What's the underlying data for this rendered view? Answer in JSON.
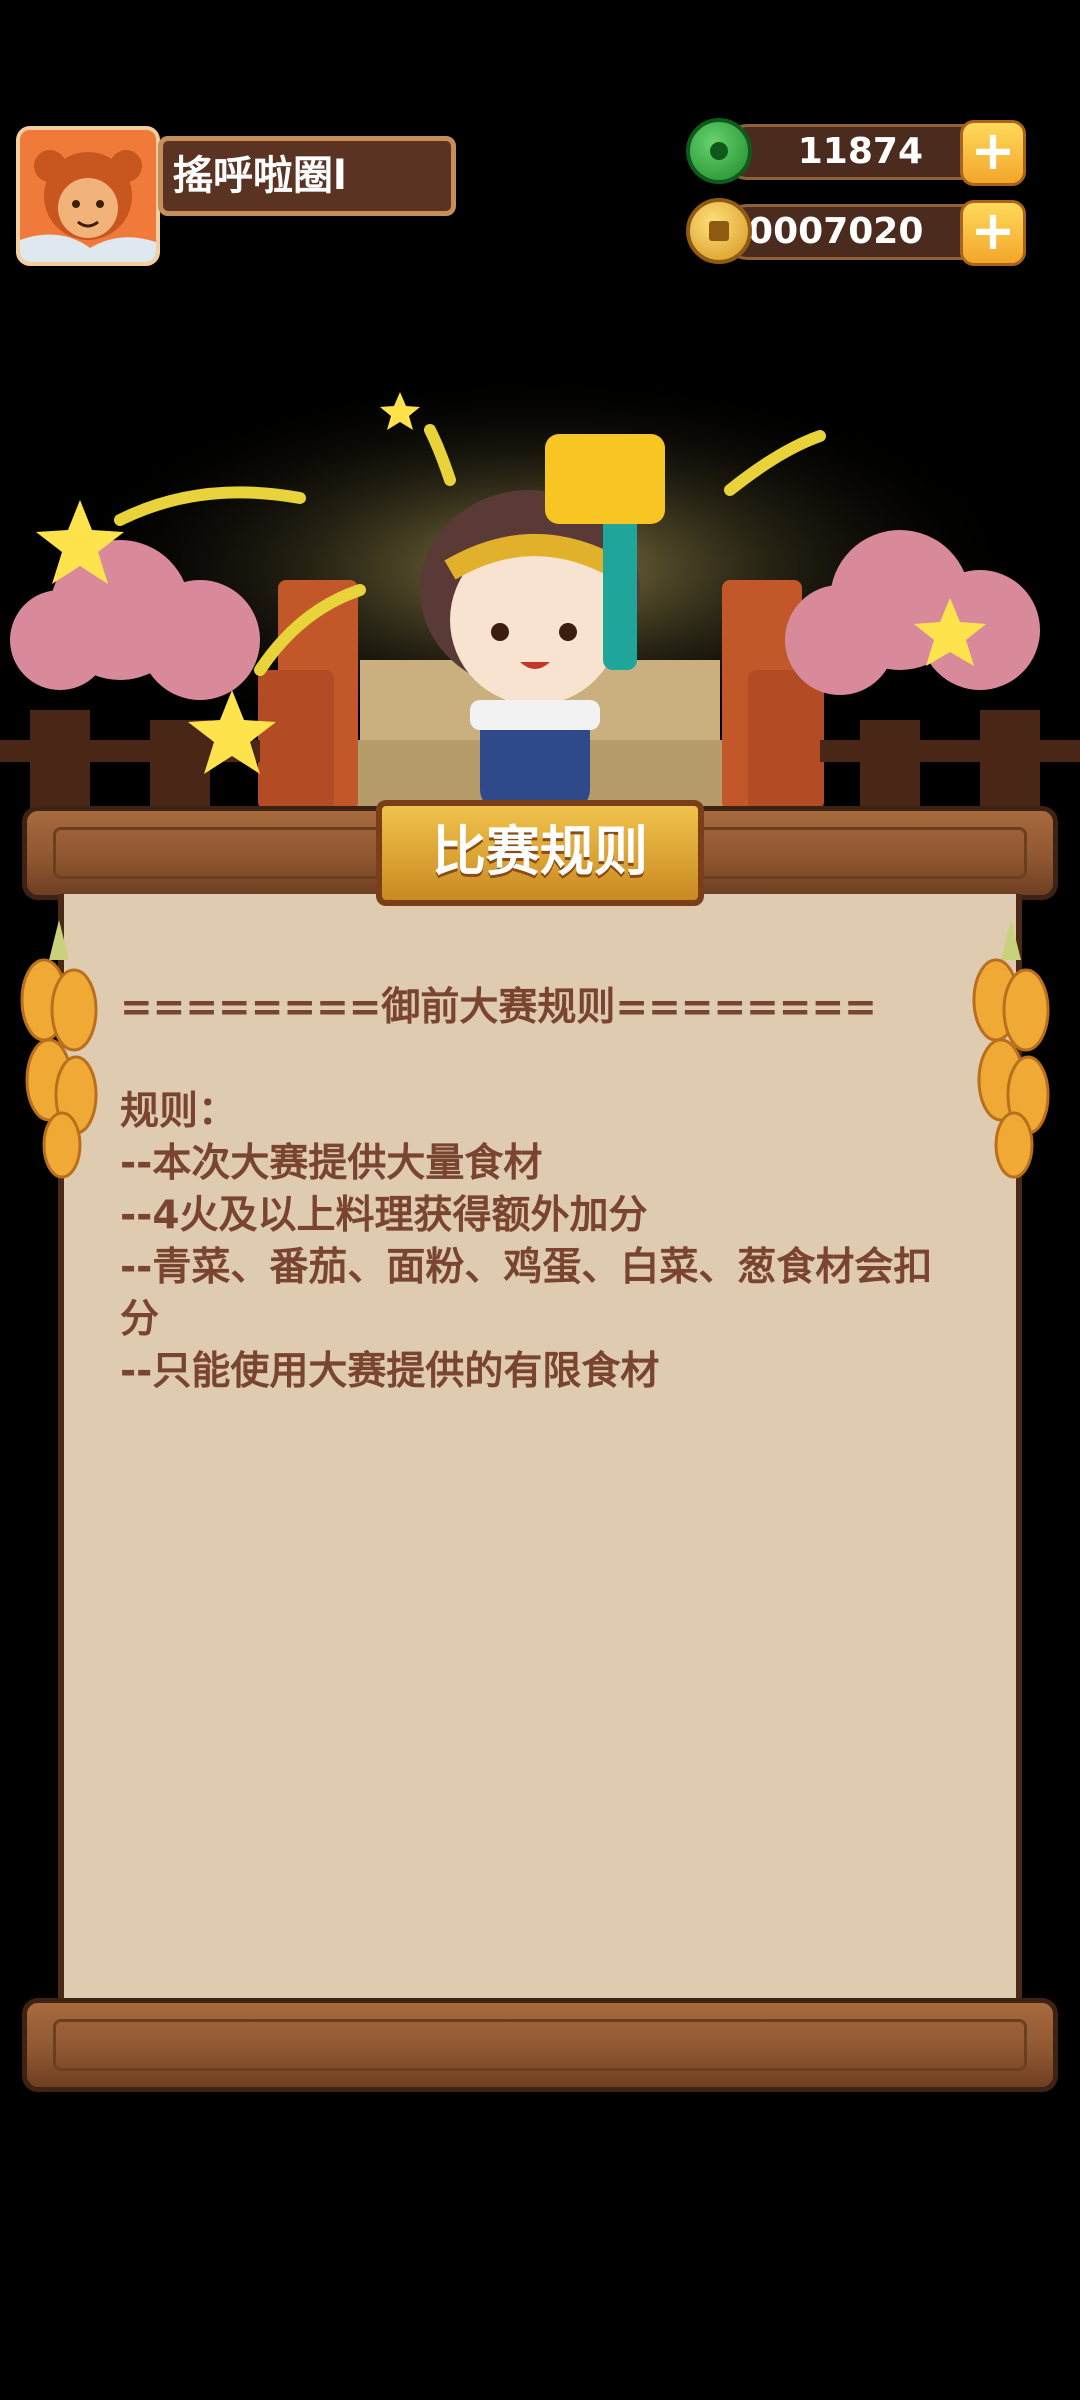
{
  "player": {
    "name": "搖呼啦圈l"
  },
  "currencies": {
    "jade": {
      "value": "11874",
      "color": "#2ea043"
    },
    "coins": {
      "value": "30007020",
      "color": "#e8b030"
    }
  },
  "panel": {
    "title": "比赛规则",
    "header_line": "========御前大赛规则========",
    "rules_label": "规则：",
    "rules": [
      "--本次大赛提供大量食材",
      "--4火及以上料理获得额外加分",
      "--青菜、番茄、面粉、鸡蛋、白菜、葱食材会扣分",
      "--只能使用大赛提供的有限食材"
    ]
  },
  "icons": [
    "avatar-portrait",
    "jade-icon",
    "coin-icon",
    "plus-icon",
    "plus-icon"
  ]
}
